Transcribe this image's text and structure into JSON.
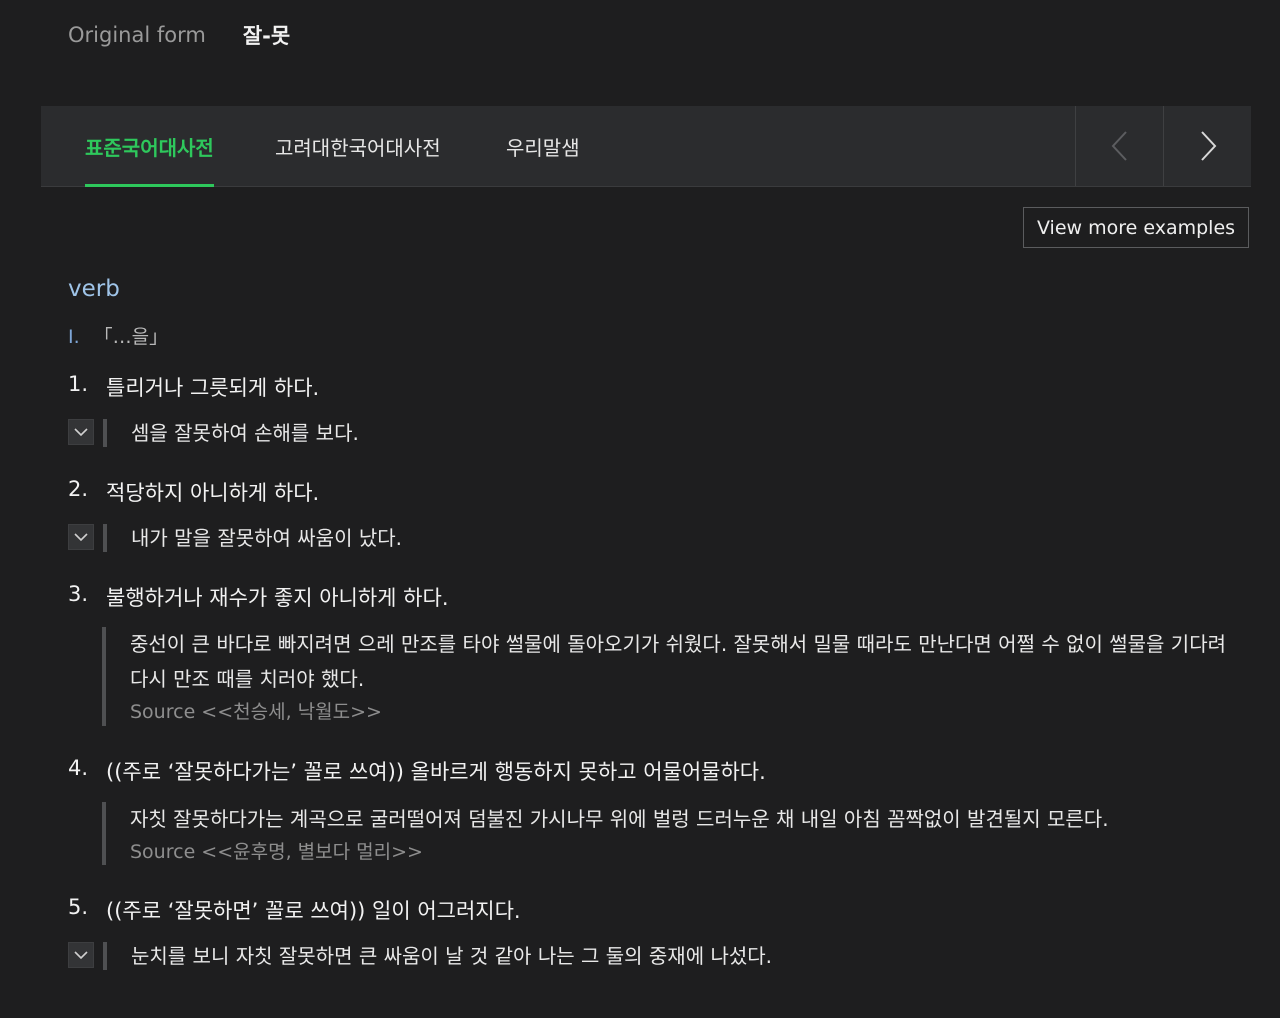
{
  "original_form": {
    "label": "Original form",
    "value": "잘-못"
  },
  "tabs": [
    {
      "label": "표준국어대사전",
      "active": true
    },
    {
      "label": "고려대한국어대사전",
      "active": false
    },
    {
      "label": "우리말샘",
      "active": false
    }
  ],
  "view_more_label": "View more examples",
  "part_of_speech": "verb",
  "subsense": {
    "roman": "I.",
    "pattern": "「…을」"
  },
  "senses": [
    {
      "num": "1.",
      "definition": "틀리거나 그릇되게 하다.",
      "example": "셈을 잘못하여 손해를 보다.",
      "source": ""
    },
    {
      "num": "2.",
      "definition": "적당하지 아니하게 하다.",
      "example": "내가 말을 잘못하여 싸움이 났다.",
      "source": ""
    },
    {
      "num": "3.",
      "definition": "불행하거나 재수가 좋지 아니하게 하다.",
      "example": "중선이 큰 바다로 빠지려면 으레 만조를 타야 썰물에 돌아오기가 쉬웠다. 잘못해서 밀물 때라도 만난다면 어쩔 수 없이 썰물을 기다려 다시 만조 때를 치러야 했다.",
      "source": "Source <<천승세, 낙월도>>"
    },
    {
      "num": "4.",
      "definition": "((주로 ‘잘못하다가는’ 꼴로 쓰여)) 올바르게 행동하지 못하고 어물어물하다.",
      "example": "자칫 잘못하다가는 계곡으로 굴러떨어져 덤불진 가시나무 위에 벌렁 드러누운 채 내일 아침 꼼짝없이 발견될지 모른다.",
      "source": "Source <<윤후명, 별보다 멀리>>"
    },
    {
      "num": "5.",
      "definition": "((주로 ‘잘못하면’ 꼴로 쓰여)) 일이 어그러지다.",
      "example": "눈치를 보니 자칫 잘못하면 큰 싸움이 날 것 같아 나는 그 둘의 중재에 나섰다.",
      "source": ""
    }
  ],
  "colors": {
    "accent": "#2ec85c",
    "background": "#1e1e1f",
    "pos": "#9fc4e8"
  },
  "icons": {
    "prev": "chevron-left-icon",
    "next": "chevron-right-icon",
    "toggle": "chevron-down-icon"
  }
}
